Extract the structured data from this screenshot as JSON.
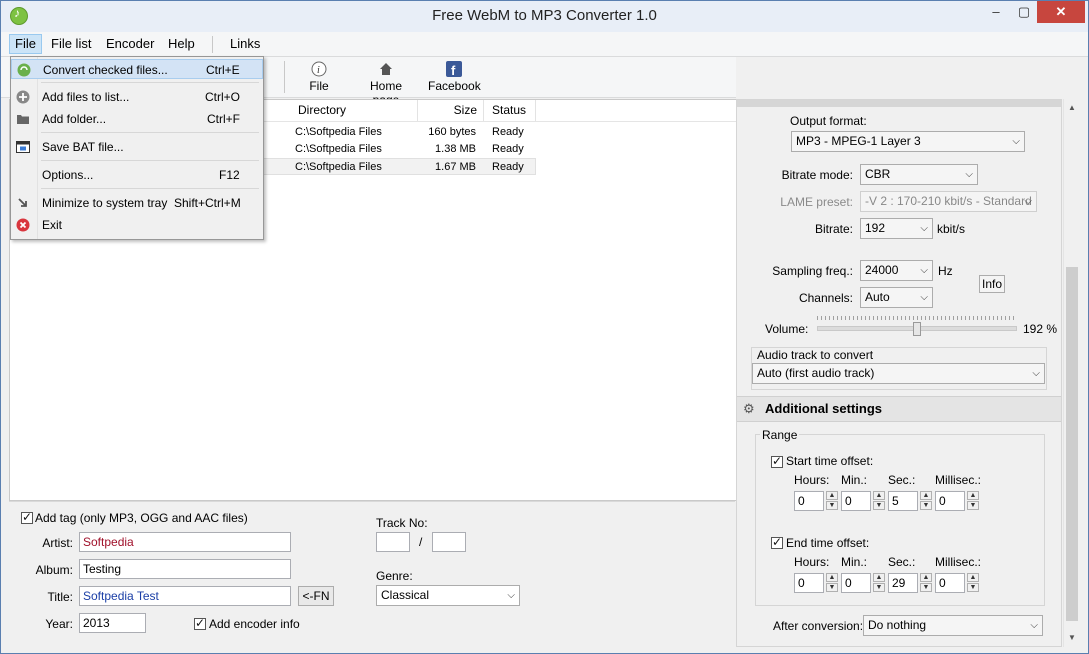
{
  "window": {
    "title": "Free WebM to MP3 Converter 1.0"
  },
  "menubar": {
    "items": [
      "File",
      "File list",
      "Encoder",
      "Help",
      "Links"
    ]
  },
  "toolbar": {
    "partial_label": "t",
    "file_label": "File",
    "home_label": "Home page",
    "facebook_label": "Facebook"
  },
  "file_menu": {
    "convert": {
      "label": "Convert checked files...",
      "shortcut": "Ctrl+E"
    },
    "add_files": {
      "label": "Add files to list...",
      "shortcut": "Ctrl+O"
    },
    "add_folder": {
      "label": "Add folder...",
      "shortcut": "Ctrl+F"
    },
    "save_bat": {
      "label": "Save BAT file...",
      "shortcut": ""
    },
    "options": {
      "label": "Options...",
      "shortcut": "F12"
    },
    "minimize": {
      "label": "Minimize to system tray",
      "shortcut": "Shift+Ctrl+M"
    },
    "exit": {
      "label": "Exit",
      "shortcut": ""
    }
  },
  "filelist": {
    "columns": {
      "directory": "Directory",
      "size": "Size",
      "status": "Status"
    },
    "rows": [
      {
        "directory": "C:\\Softpedia Files",
        "size": "160 bytes",
        "status": "Ready"
      },
      {
        "directory": "C:\\Softpedia Files",
        "size": "1.38 MB",
        "status": "Ready"
      },
      {
        "directory": "C:\\Softpedia Files",
        "size": "1.67 MB",
        "status": "Ready"
      }
    ]
  },
  "tags": {
    "add_tag_label": "Add tag (only MP3, OGG and AAC files)",
    "artist_label": "Artist:",
    "artist_value": "Softpedia",
    "album_label": "Album:",
    "album_value": "Testing",
    "title_label": "Title:",
    "title_value": "Softpedia Test",
    "fn_button": "<-FN",
    "year_label": "Year:",
    "year_value": "2013",
    "encoder_info_label": "Add encoder info",
    "track_label": "Track No:",
    "track_sep": "/",
    "genre_label": "Genre:",
    "genre_value": "Classical"
  },
  "encoder": {
    "output_format_label": "Output format:",
    "output_format_value": "MP3 - MPEG-1 Layer 3",
    "bitrate_mode_label": "Bitrate mode:",
    "bitrate_mode_value": "CBR",
    "lame_preset_label": "LAME preset:",
    "lame_preset_value": "-V 2 : 170-210 kbit/s - Standard",
    "bitrate_label": "Bitrate:",
    "bitrate_value": "192",
    "bitrate_unit": "kbit/s",
    "sampling_label": "Sampling freq.:",
    "sampling_value": "24000",
    "sampling_unit": "Hz",
    "info_button": "Info",
    "channels_label": "Channels:",
    "channels_value": "Auto",
    "volume_label": "Volume:",
    "volume_value": "192 %",
    "volume_fraction": 0.5,
    "audio_track_label": "Audio track to convert",
    "audio_track_value": "Auto (first audio track)"
  },
  "additional": {
    "title": "Additional settings",
    "range_label": "Range",
    "start_label": "Start time offset:",
    "end_label": "End time offset:",
    "hours_label": "Hours:",
    "min_label": "Min.:",
    "sec_label": "Sec.:",
    "ms_label": "Millisec.:",
    "start": {
      "hours": "0",
      "min": "0",
      "sec": "5",
      "ms": "0"
    },
    "end": {
      "hours": "0",
      "min": "0",
      "sec": "29",
      "ms": "0"
    },
    "after_label": "After conversion:",
    "after_value": "Do nothing"
  }
}
